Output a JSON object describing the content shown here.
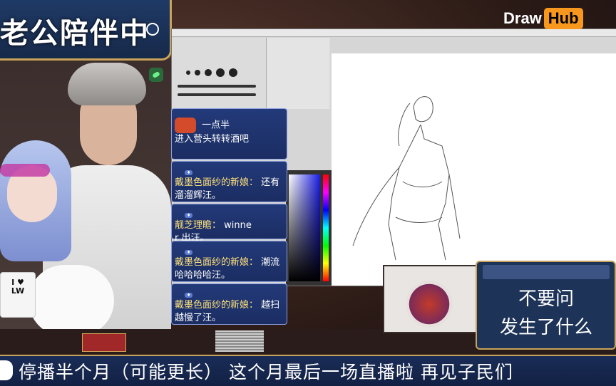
{
  "banner": {
    "title": "老公陪伴中"
  },
  "logo": {
    "part1": "Draw",
    "part2": "Hub"
  },
  "mug": {
    "line1": "I ♥",
    "line2": "LW"
  },
  "chat": {
    "messages": [
      {
        "name": "一点半",
        "text": "进入营头转转酒吧"
      },
      {
        "name": "戴墨色面纱的新娘：",
        "name_extra": "还有",
        "text": "溜溜辉汪。"
      },
      {
        "name": "靓芝理瞻：",
        "name_extra": "winne",
        "text": "r 出汪。"
      },
      {
        "name": "戴墨色面纱的新娘：",
        "name_extra": "潮流",
        "text": "哈哈哈哈汪。"
      },
      {
        "name": "戴墨色面纱的新娘：",
        "name_extra": "越扫",
        "text": "越慢了汪。"
      }
    ]
  },
  "notice": {
    "line1": "不要问",
    "line2": "发生了什么"
  },
  "ticker": {
    "text": "停播半个月（可能更长） 这个月最后一场直播啦 再见子民们"
  },
  "colors": {
    "accent": "#c9a35a",
    "panel": "#1e3358",
    "logo_orange": "#f7971d"
  }
}
